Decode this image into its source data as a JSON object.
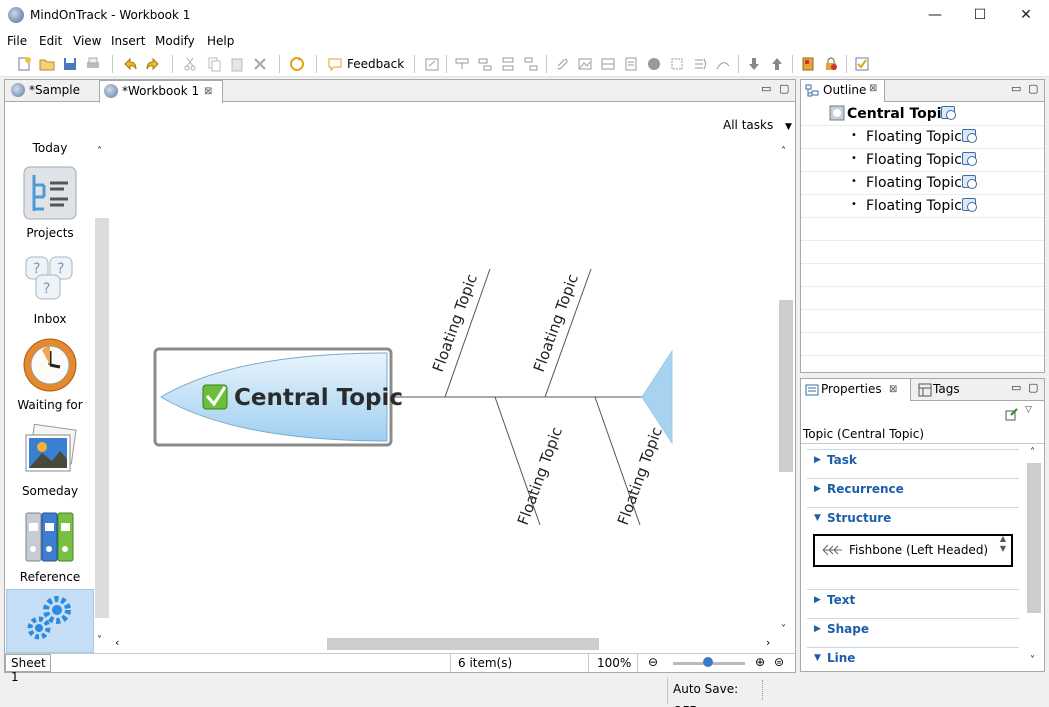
{
  "window": {
    "title": "MindOnTrack - Workbook 1",
    "minimize": "—",
    "maximize": "☐",
    "close": "✕"
  },
  "menu": [
    "File",
    "Edit",
    "View",
    "Insert",
    "Modify",
    "Help"
  ],
  "toolbar": {
    "feedback_label": "Feedback"
  },
  "editor": {
    "tabs": [
      {
        "label": "*Sample"
      },
      {
        "label": "*Workbook 1"
      }
    ],
    "all_tasks": "All tasks",
    "gtd": [
      {
        "label": "Today",
        "icon": "today-icon"
      },
      {
        "label": "Projects",
        "icon": "projects-icon"
      },
      {
        "label": "Inbox",
        "icon": "inbox-icon"
      },
      {
        "label": "Waiting for",
        "icon": "clock-icon"
      },
      {
        "label": "Someday",
        "icon": "picture-icon"
      },
      {
        "label": "Reference",
        "icon": "binders-icon"
      },
      {
        "label": "",
        "icon": "gears-icon"
      }
    ],
    "map": {
      "central_topic": "Central Topic",
      "topics": [
        "Floating Topic",
        "Floating Topic",
        "Floating Topic",
        "Floating Topic"
      ]
    },
    "status": {
      "sheet": "Sheet 1",
      "items": "6 item(s)",
      "zoom": "100%"
    }
  },
  "outline": {
    "tab_label": "Outline",
    "root": "Central Topic",
    "children": [
      "Floating Topic",
      "Floating Topic",
      "Floating Topic",
      "Floating Topic"
    ]
  },
  "properties": {
    "tab_label": "Properties",
    "tags_label": "Tags",
    "subject": "Topic (Central Topic)",
    "sections": [
      {
        "label": "Task",
        "expanded": false
      },
      {
        "label": "Recurrence",
        "expanded": false
      },
      {
        "label": "Structure",
        "expanded": true
      },
      {
        "label": "Text",
        "expanded": false
      },
      {
        "label": "Shape",
        "expanded": false
      },
      {
        "label": "Line",
        "expanded": true
      }
    ],
    "structure_value": "Fishbone (Left Headed)"
  },
  "statusbar": {
    "autosave": "Auto Save: OFF"
  }
}
